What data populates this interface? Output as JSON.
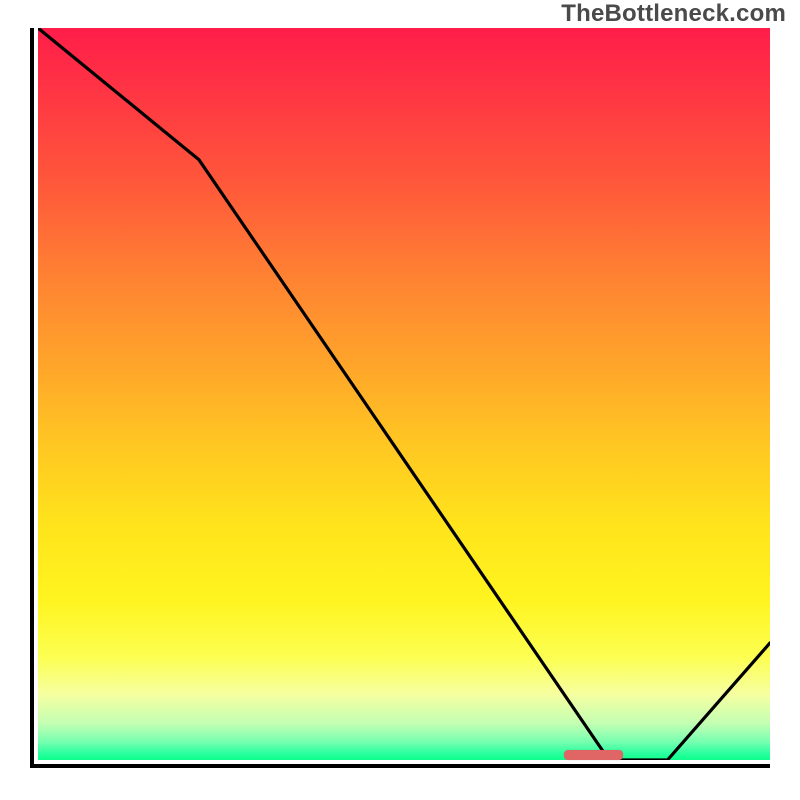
{
  "watermark": "TheBottleneck.com",
  "colors": {
    "line": "#000000",
    "marker": "#e06666",
    "axis": "#000000"
  },
  "chart_data": {
    "type": "line",
    "title": "",
    "xlabel": "",
    "ylabel": "",
    "xlim": [
      0,
      100
    ],
    "ylim": [
      0,
      100
    ],
    "x": [
      0,
      22,
      78,
      86,
      100
    ],
    "values": [
      100,
      82,
      0,
      0,
      16
    ],
    "marker": {
      "x_start": 72,
      "x_end": 80,
      "y": 0
    },
    "background_gradient": {
      "stops": [
        {
          "pos": 0,
          "color": "#ff1d4a"
        },
        {
          "pos": 0.22,
          "color": "#ff5a3a"
        },
        {
          "pos": 0.46,
          "color": "#ffa52a"
        },
        {
          "pos": 0.68,
          "color": "#ffe41c"
        },
        {
          "pos": 0.86,
          "color": "#fcff52"
        },
        {
          "pos": 0.95,
          "color": "#c3ffb3"
        },
        {
          "pos": 1.0,
          "color": "#0cff8a"
        }
      ]
    }
  }
}
